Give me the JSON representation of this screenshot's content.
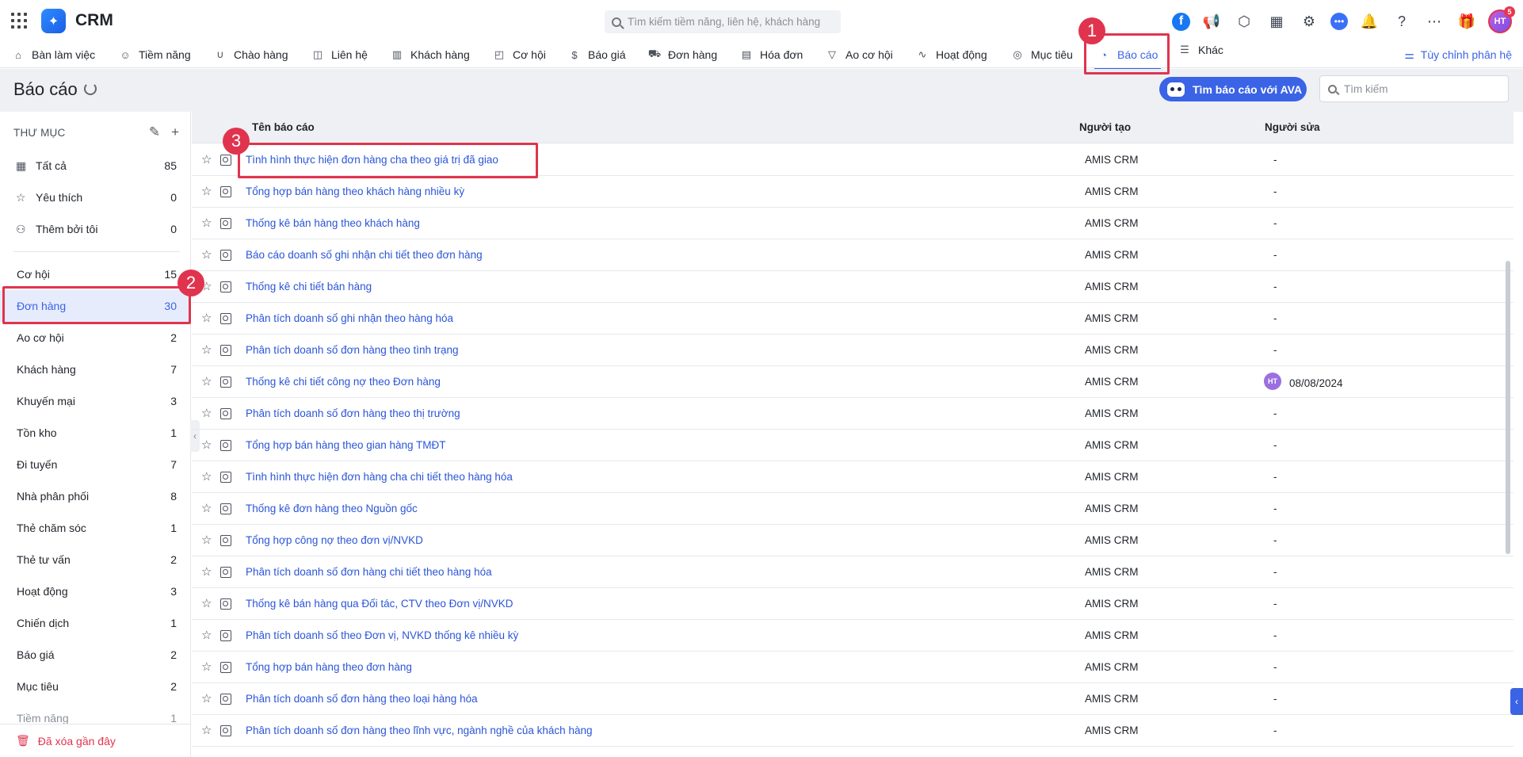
{
  "app": {
    "name": "CRM",
    "search_placeholder": "Tìm kiếm tiềm năng, liên hệ, khách hàng",
    "avatar_initials": "HT",
    "notification_count": "5"
  },
  "nav": {
    "items": [
      {
        "label": "Bàn làm việc",
        "icon": "desk-icon"
      },
      {
        "label": "Tiềm năng",
        "icon": "lead-icon"
      },
      {
        "label": "Chào hàng",
        "icon": "magnet-icon"
      },
      {
        "label": "Liên hệ",
        "icon": "contact-icon"
      },
      {
        "label": "Khách hàng",
        "icon": "building-icon"
      },
      {
        "label": "Cơ hội",
        "icon": "briefcase-icon"
      },
      {
        "label": "Báo giá",
        "icon": "quote-icon"
      },
      {
        "label": "Đơn hàng",
        "icon": "cart-icon"
      },
      {
        "label": "Hóa đơn",
        "icon": "invoice-icon"
      },
      {
        "label": "Ao cơ hội",
        "icon": "funnel-icon"
      },
      {
        "label": "Hoạt động",
        "icon": "activity-icon"
      },
      {
        "label": "Mục tiêu",
        "icon": "target-icon"
      },
      {
        "label": "Báo cáo",
        "icon": "report-icon"
      },
      {
        "label": "Khác",
        "icon": "menu-icon"
      }
    ],
    "customize_label": "Tùy chỉnh phân hệ"
  },
  "header": {
    "title": "Báo cáo",
    "ava_button": "Tìm báo cáo với AVA",
    "search_placeholder": "Tìm kiếm"
  },
  "sidebar": {
    "folder_title": "THƯ MỤC",
    "pinned": [
      {
        "label": "Tất cả",
        "count": "85",
        "icon": "grid-icon"
      },
      {
        "label": "Yêu thích",
        "count": "0",
        "icon": "star-icon"
      },
      {
        "label": "Thêm bởi tôi",
        "count": "0",
        "icon": "user-add-icon"
      }
    ],
    "folders": [
      {
        "label": "Cơ hội",
        "count": "15"
      },
      {
        "label": "Đơn hàng",
        "count": "30"
      },
      {
        "label": "Ao cơ hội",
        "count": "2"
      },
      {
        "label": "Khách hàng",
        "count": "7"
      },
      {
        "label": "Khuyến mại",
        "count": "3"
      },
      {
        "label": "Tồn kho",
        "count": "1"
      },
      {
        "label": "Đi tuyến",
        "count": "7"
      },
      {
        "label": "Nhà phân phối",
        "count": "8"
      },
      {
        "label": "Thẻ chăm sóc",
        "count": "1"
      },
      {
        "label": "Thẻ tư vấn",
        "count": "2"
      },
      {
        "label": "Hoạt động",
        "count": "3"
      },
      {
        "label": "Chiến dịch",
        "count": "1"
      },
      {
        "label": "Báo giá",
        "count": "2"
      },
      {
        "label": "Mục tiêu",
        "count": "2"
      },
      {
        "label": "Tiềm năng",
        "count": "1"
      }
    ],
    "deleted_label": "Đã xóa gần đây"
  },
  "table": {
    "headers": {
      "name": "Tên báo cáo",
      "creator": "Người tạo",
      "editor": "Người sửa"
    },
    "rows": [
      {
        "name": "Tình hình thực hiện đơn hàng cha theo giá trị đã giao",
        "creator": "AMIS CRM",
        "editor": "-"
      },
      {
        "name": "Tổng hợp bán hàng theo khách hàng nhiều kỳ",
        "creator": "AMIS CRM",
        "editor": "-"
      },
      {
        "name": "Thống kê bán hàng theo khách hàng",
        "creator": "AMIS CRM",
        "editor": "-"
      },
      {
        "name": "Báo cáo doanh số ghi nhận chi tiết theo đơn hàng",
        "creator": "AMIS CRM",
        "editor": "-"
      },
      {
        "name": "Thống kê chi tiết bán hàng",
        "creator": "AMIS CRM",
        "editor": "-"
      },
      {
        "name": "Phân tích doanh số ghi nhận theo hàng hóa",
        "creator": "AMIS CRM",
        "editor": "-"
      },
      {
        "name": "Phân tích doanh số đơn hàng theo tình trạng",
        "creator": "AMIS CRM",
        "editor": "-"
      },
      {
        "name": "Thống kê chi tiết công nợ theo Đơn hàng",
        "creator": "AMIS CRM",
        "editor": "08/08/2024",
        "editor_avatar": "HT"
      },
      {
        "name": "Phân tích doanh số đơn hàng theo thị trường",
        "creator": "AMIS CRM",
        "editor": "-"
      },
      {
        "name": "Tổng hợp bán hàng theo gian hàng TMĐT",
        "creator": "AMIS CRM",
        "editor": "-"
      },
      {
        "name": "Tình hình thực hiện đơn hàng cha chi tiết theo hàng hóa",
        "creator": "AMIS CRM",
        "editor": "-"
      },
      {
        "name": "Thống kê đơn hàng theo Nguồn gốc",
        "creator": "AMIS CRM",
        "editor": "-"
      },
      {
        "name": "Tổng hợp công nợ theo đơn vị/NVKD",
        "creator": "AMIS CRM",
        "editor": "-"
      },
      {
        "name": "Phân tích doanh số đơn hàng chi tiết theo hàng hóa",
        "creator": "AMIS CRM",
        "editor": "-"
      },
      {
        "name": "Thống kê bán hàng qua Đối tác, CTV theo Đơn vị/NVKD",
        "creator": "AMIS CRM",
        "editor": "-"
      },
      {
        "name": "Phân tích doanh số theo Đơn vị, NVKD thống kê nhiều kỳ",
        "creator": "AMIS CRM",
        "editor": "-"
      },
      {
        "name": "Tổng hợp bán hàng theo đơn hàng",
        "creator": "AMIS CRM",
        "editor": "-"
      },
      {
        "name": "Phân tích doanh số đơn hàng theo loại hàng hóa",
        "creator": "AMIS CRM",
        "editor": "-"
      },
      {
        "name": "Phân tích doanh số đơn hàng theo lĩnh vực, ngành nghề của khách hàng",
        "creator": "AMIS CRM",
        "editor": "-"
      }
    ]
  },
  "annotations": [
    "1",
    "2",
    "3"
  ]
}
